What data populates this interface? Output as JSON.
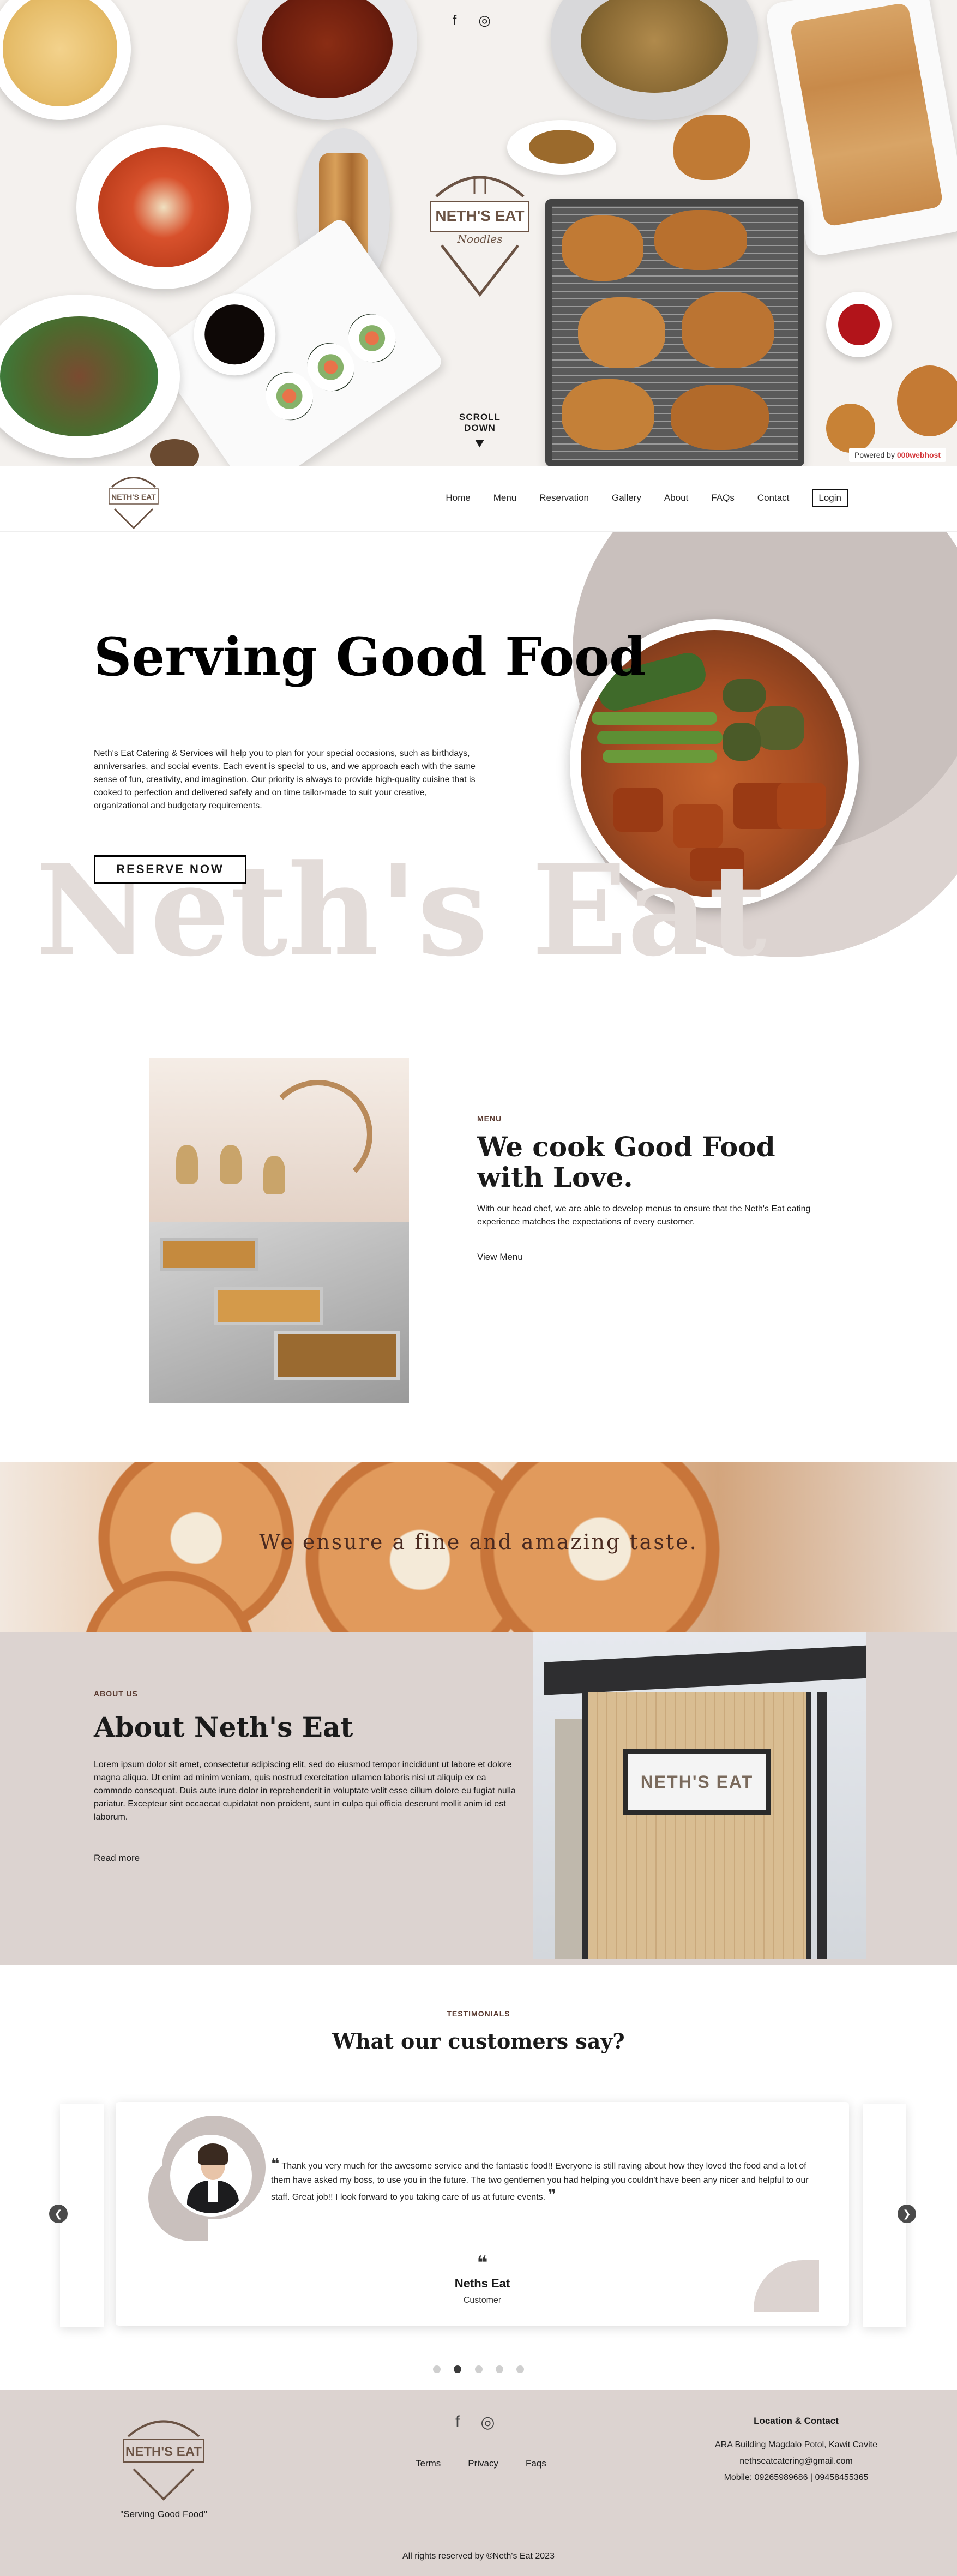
{
  "hero": {
    "social": [
      "f",
      "◎"
    ],
    "logo_text": "NETH'S EAT",
    "logo_script": "Noodles",
    "scroll_label": "SCROLL DOWN",
    "scroll_icon": "chevrons-down-icon",
    "powered_prefix": "Powered by",
    "powered_brand": "000webhost"
  },
  "nav": {
    "logo_text": "NETH'S EAT",
    "items": [
      "Home",
      "Menu",
      "Reservation",
      "Gallery",
      "About",
      "FAQs",
      "Contact",
      "Login"
    ]
  },
  "serving": {
    "title": "Serving Good Food",
    "description": "Neth's Eat Catering & Services will help you to plan for your special occasions, such as birthdays, anniversaries, and social events. Each event is special to us, and we approach each with the same sense of fun, creativity, and imagination. Our priority is always to provide high-quality cuisine that is cooked to perfection and delivered safely and on time tailor-made to suit your creative, organizational and budgetary requirements.",
    "button": "RESERVE NOW",
    "watermark": "Neth's Eat"
  },
  "menu": {
    "label": "MENU",
    "title": "We cook Good Food with Love.",
    "description": "With our head chef, we are able to develop menus to ensure that the Neth's Eat eating experience matches the expectations of every customer.",
    "link": "View Menu"
  },
  "banner": {
    "text": "We ensure a fine and amazing taste."
  },
  "about": {
    "label": "ABOUT US",
    "title": "About Neth's Eat",
    "description": "Lorem ipsum dolor sit amet, consectetur adipiscing elit, sed do eiusmod tempor incididunt ut labore et dolore magna aliqua. Ut enim ad minim veniam, quis nostrud exercitation ullamco laboris nisi ut aliquip ex ea commodo consequat. Duis aute irure dolor in reprehenderit in voluptate velit esse cillum dolore eu fugiat nulla pariatur. Excepteur sint occaecat cupidatat non proident, sunt in culpa qui officia deserunt mollit anim id est laborum.",
    "link": "Read more",
    "sign_text": "NETH'S EAT"
  },
  "testimonials": {
    "label": "TESTIMONIALS",
    "title": "What our customers say?",
    "quote": "Thank you very much for the awesome service and the fantastic food!! Everyone is still raving about how they loved the food and a lot of them have asked my boss, to use you in the future. The two gentlemen you had helping you couldn't have been any nicer and helpful to our staff. Great job!! I look forward to you taking care of us at future events.",
    "name": "Neths Eat",
    "role": "Customer",
    "dots": 5,
    "active_dot": 2
  },
  "footer": {
    "logo_text": "NETH'S EAT",
    "tagline": "\"Serving Good Food\"",
    "links": [
      "Terms",
      "Privacy",
      "Faqs"
    ],
    "contact_heading": "Location & Contact",
    "address": "ARA Building Magdalo Potol, Kawit Cavite",
    "email": "nethseatcatering@gmail.com",
    "mobile": "Mobile: 09265989686 | 09458455365",
    "copyright": "All rights reserved by ©Neth's Eat 2023"
  },
  "colors": {
    "accent_beige": "#dcd3d0",
    "accent_taupe": "#c9c0bd",
    "brand_brown": "#6b5344"
  }
}
